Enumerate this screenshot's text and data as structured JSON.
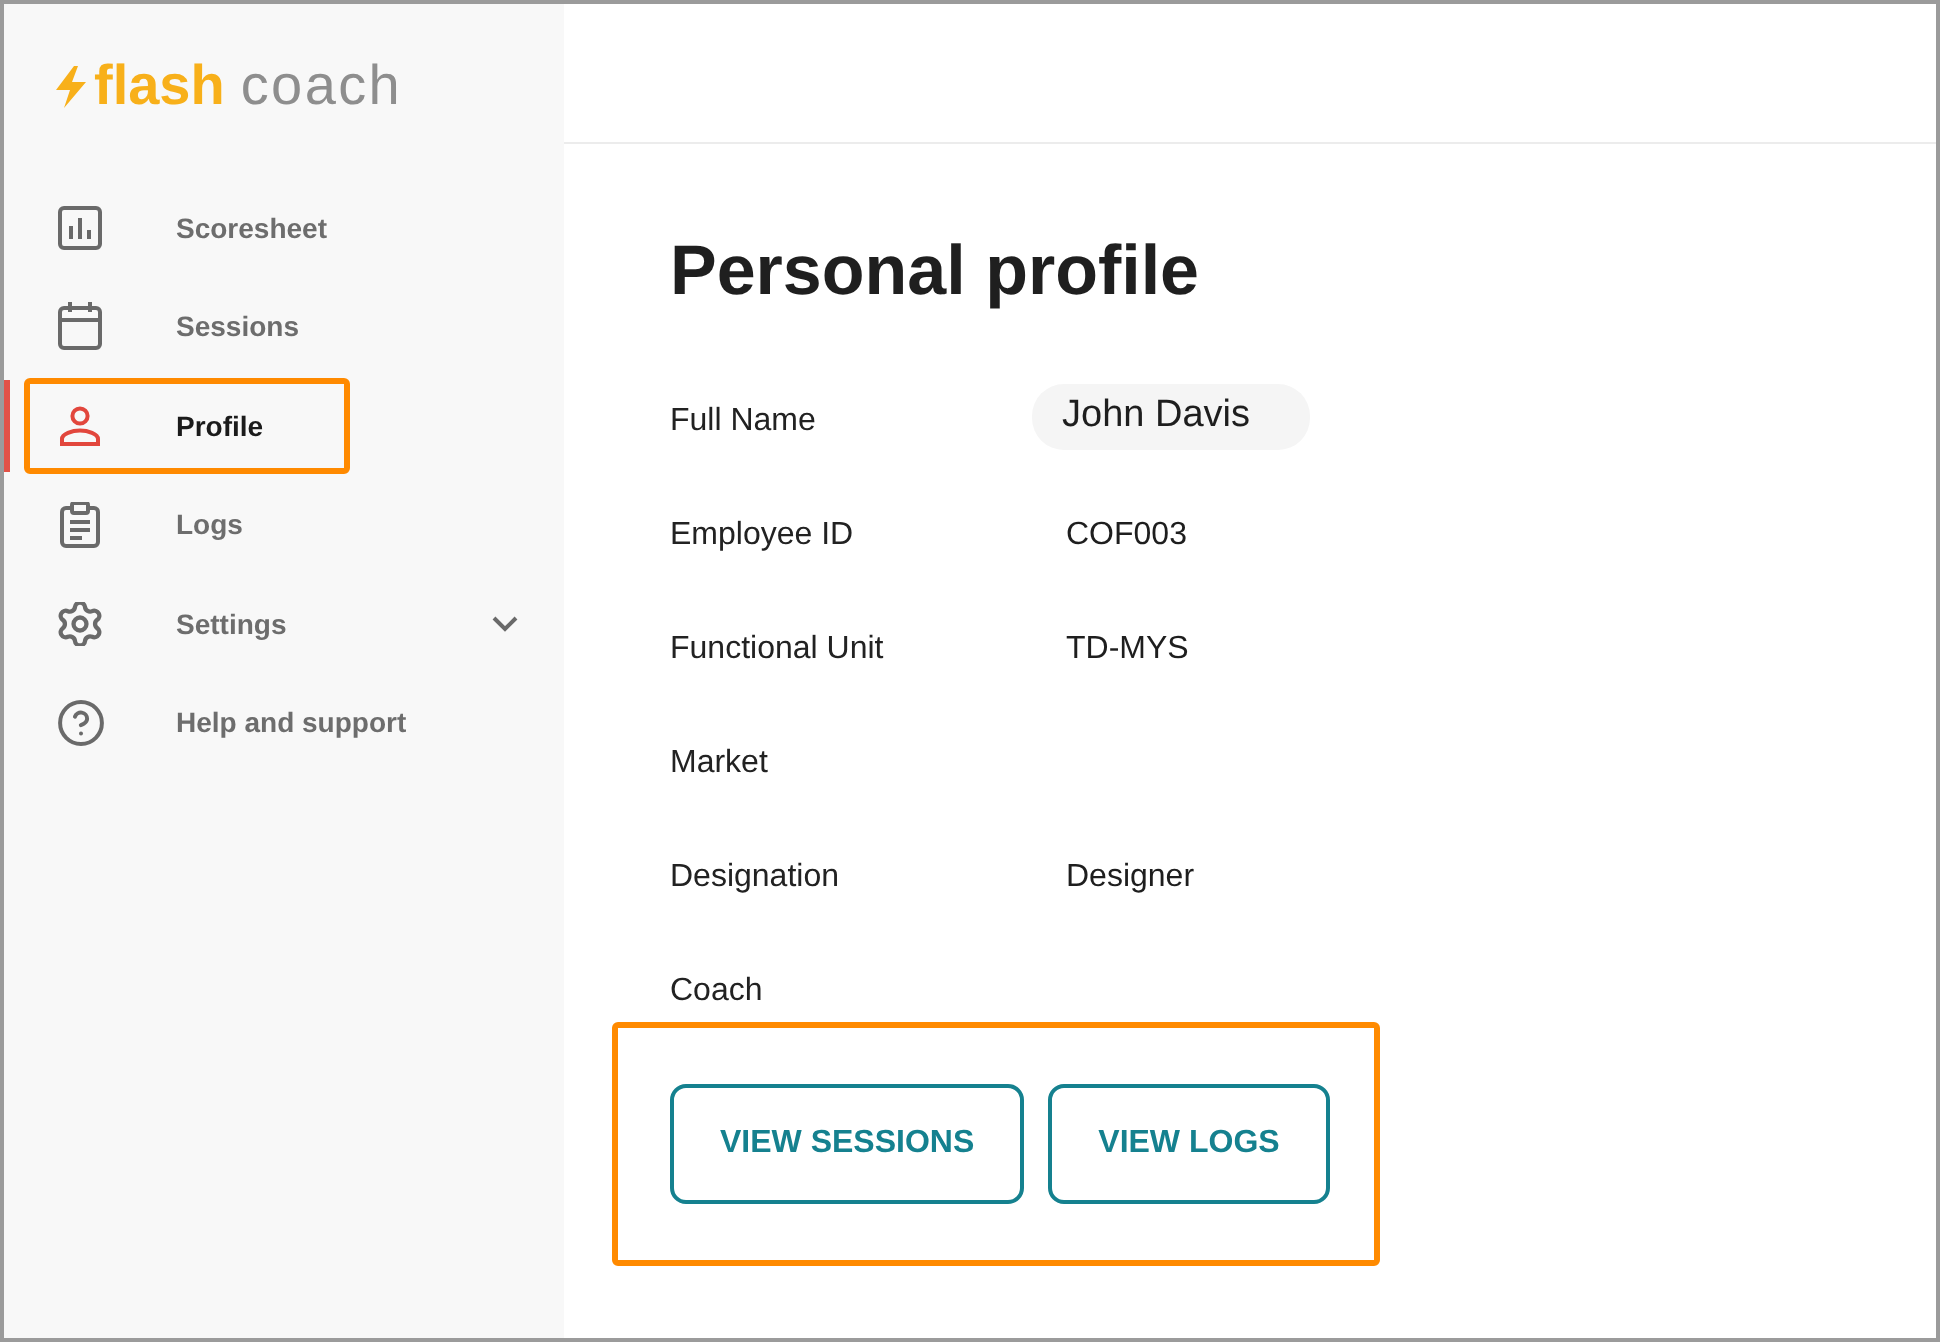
{
  "logo": {
    "brand": "flash",
    "product": "coach"
  },
  "sidebar": {
    "items": [
      {
        "label": "Scoresheet",
        "kind": "link",
        "selected": false,
        "highlighted": false
      },
      {
        "label": "Sessions",
        "kind": "link",
        "selected": false,
        "highlighted": false
      },
      {
        "label": "Profile",
        "kind": "link",
        "selected": true,
        "highlighted": true
      },
      {
        "label": "Logs",
        "kind": "link",
        "selected": false,
        "highlighted": false
      },
      {
        "label": "Settings",
        "kind": "group",
        "expanded": false,
        "selected": false,
        "highlighted": false
      },
      {
        "label": "Help and support",
        "kind": "link",
        "selected": false,
        "highlighted": false
      }
    ]
  },
  "profile": {
    "title": "Personal profile",
    "fields": [
      {
        "label": "Full Name",
        "value": "John Davis",
        "kind": "retouched"
      },
      {
        "label": "Employee ID",
        "value": "COF003",
        "kind": "plain"
      },
      {
        "label": "Functional Unit",
        "value": "TD-MYS",
        "kind": "plain"
      },
      {
        "label": "Market"
      },
      {
        "label": "Designation",
        "value": "Designer",
        "kind": "plain"
      },
      {
        "label": "Coach"
      }
    ],
    "actions": {
      "highlighted": true,
      "buttons": [
        {
          "label": "VIEW SESSIONS"
        },
        {
          "label": "VIEW LOGS"
        }
      ]
    }
  }
}
